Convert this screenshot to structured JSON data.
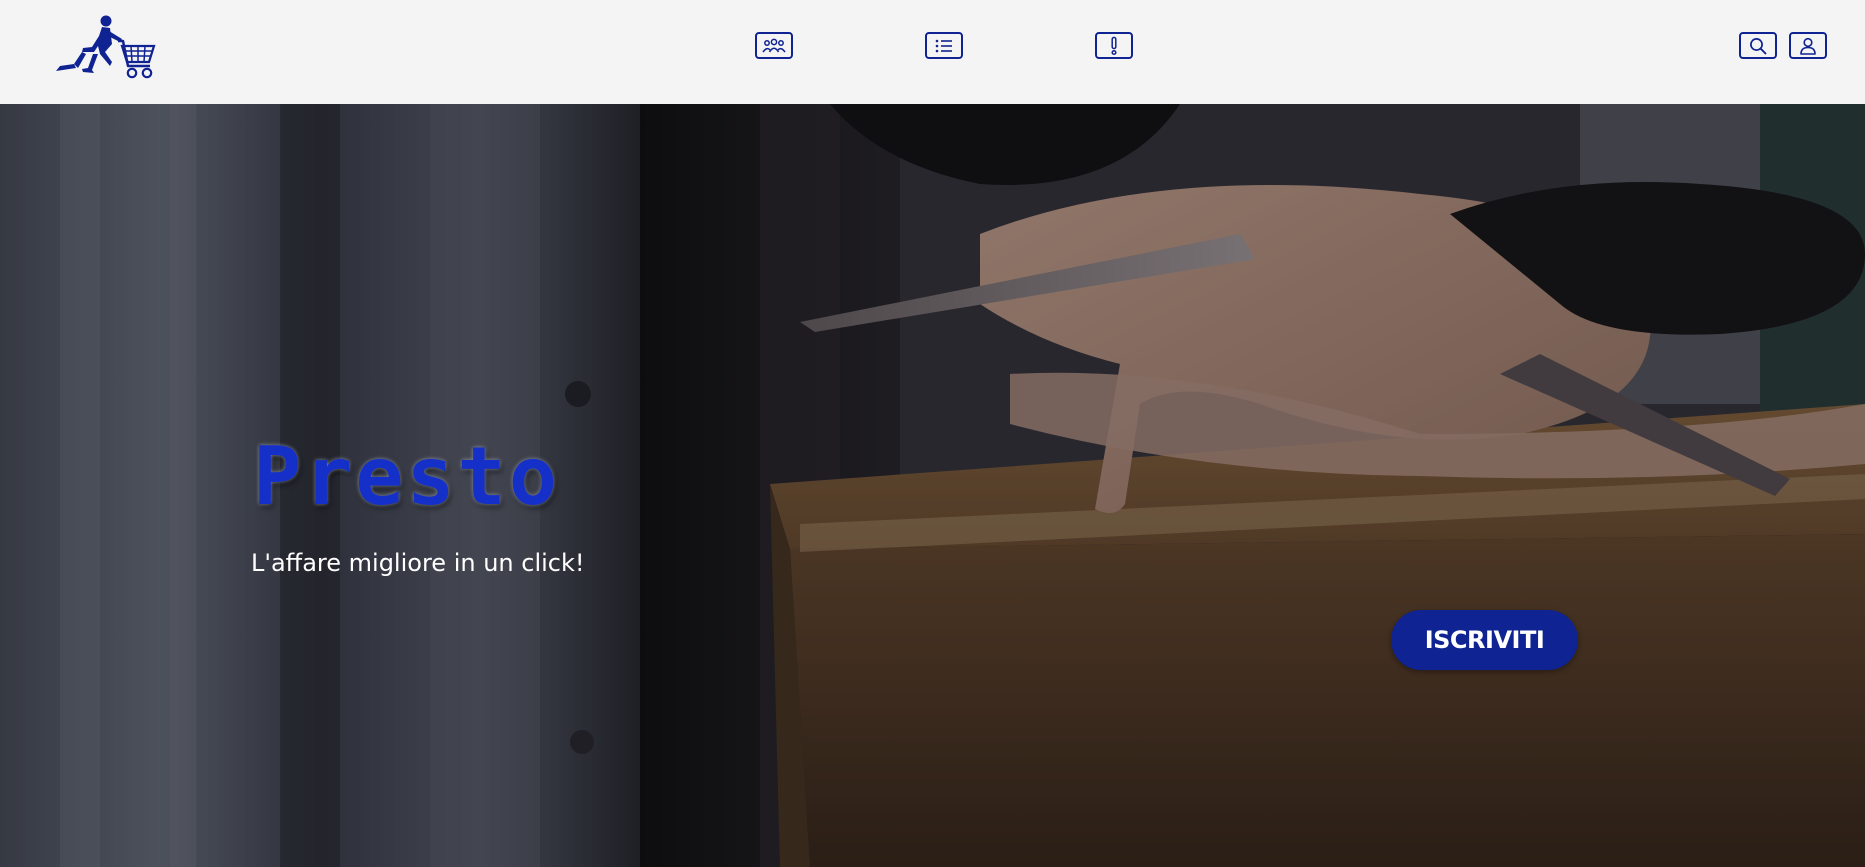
{
  "app": {
    "brand_color": "#0f2393",
    "logo": "running-shopper-cart-logo"
  },
  "navbar": {
    "center_icons": [
      "group-icon",
      "list-icon",
      "exclamation-icon"
    ],
    "right_icons": [
      "search-icon",
      "user-icon"
    ]
  },
  "hero": {
    "title": "Presto",
    "subtitle": "L'affare migliore in un click!",
    "cta_label": "ISCRIVITI",
    "background": "hands-cutting-cardboard-box-tape-photo"
  }
}
